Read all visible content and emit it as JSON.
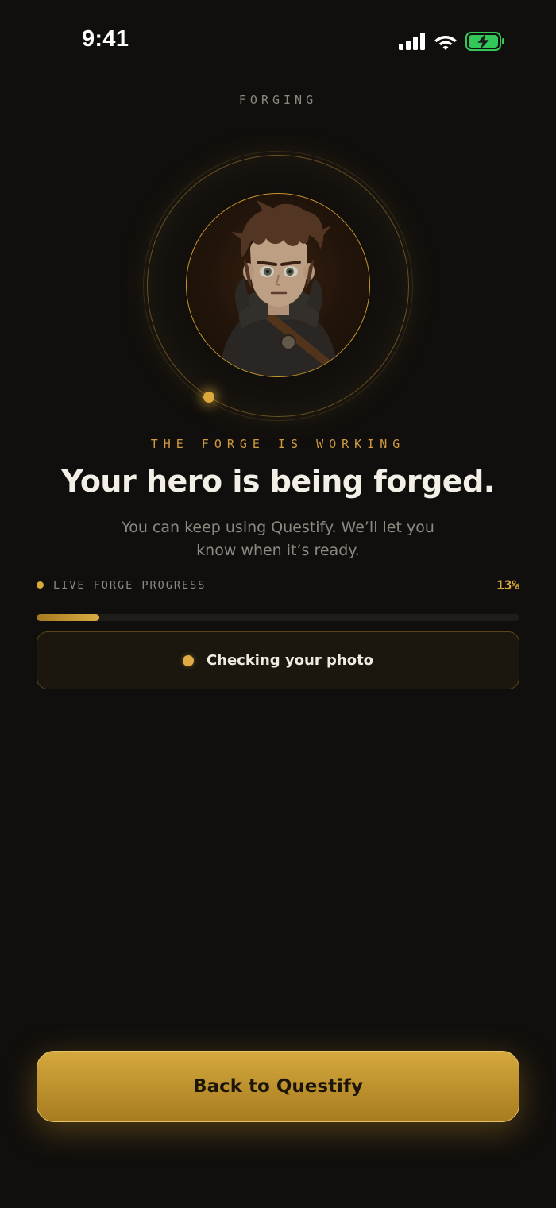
{
  "status_bar": {
    "time": "9:41",
    "icons": [
      "cellular-signal-icon",
      "wifi-icon",
      "battery-charging-icon"
    ],
    "battery_color": "#34c759"
  },
  "screen_label": "FORGING",
  "hero": {
    "portrait_icon": "hero-portrait",
    "eyebrow": "THE FORGE IS WORKING",
    "headline": "Your hero is being forged.",
    "subtitle": "You can keep using Questify. We’ll let you know when it’s ready."
  },
  "progress": {
    "label": "LIVE FORGE PROGRESS",
    "percent_text": "13%",
    "fraction": 0.13
  },
  "current_step": {
    "label": "Checking your photo"
  },
  "actions": {
    "back_label": "Back to Questify"
  },
  "colors": {
    "background": "#110f0d",
    "accent": "#d9a73b",
    "button": "#c99b34"
  }
}
